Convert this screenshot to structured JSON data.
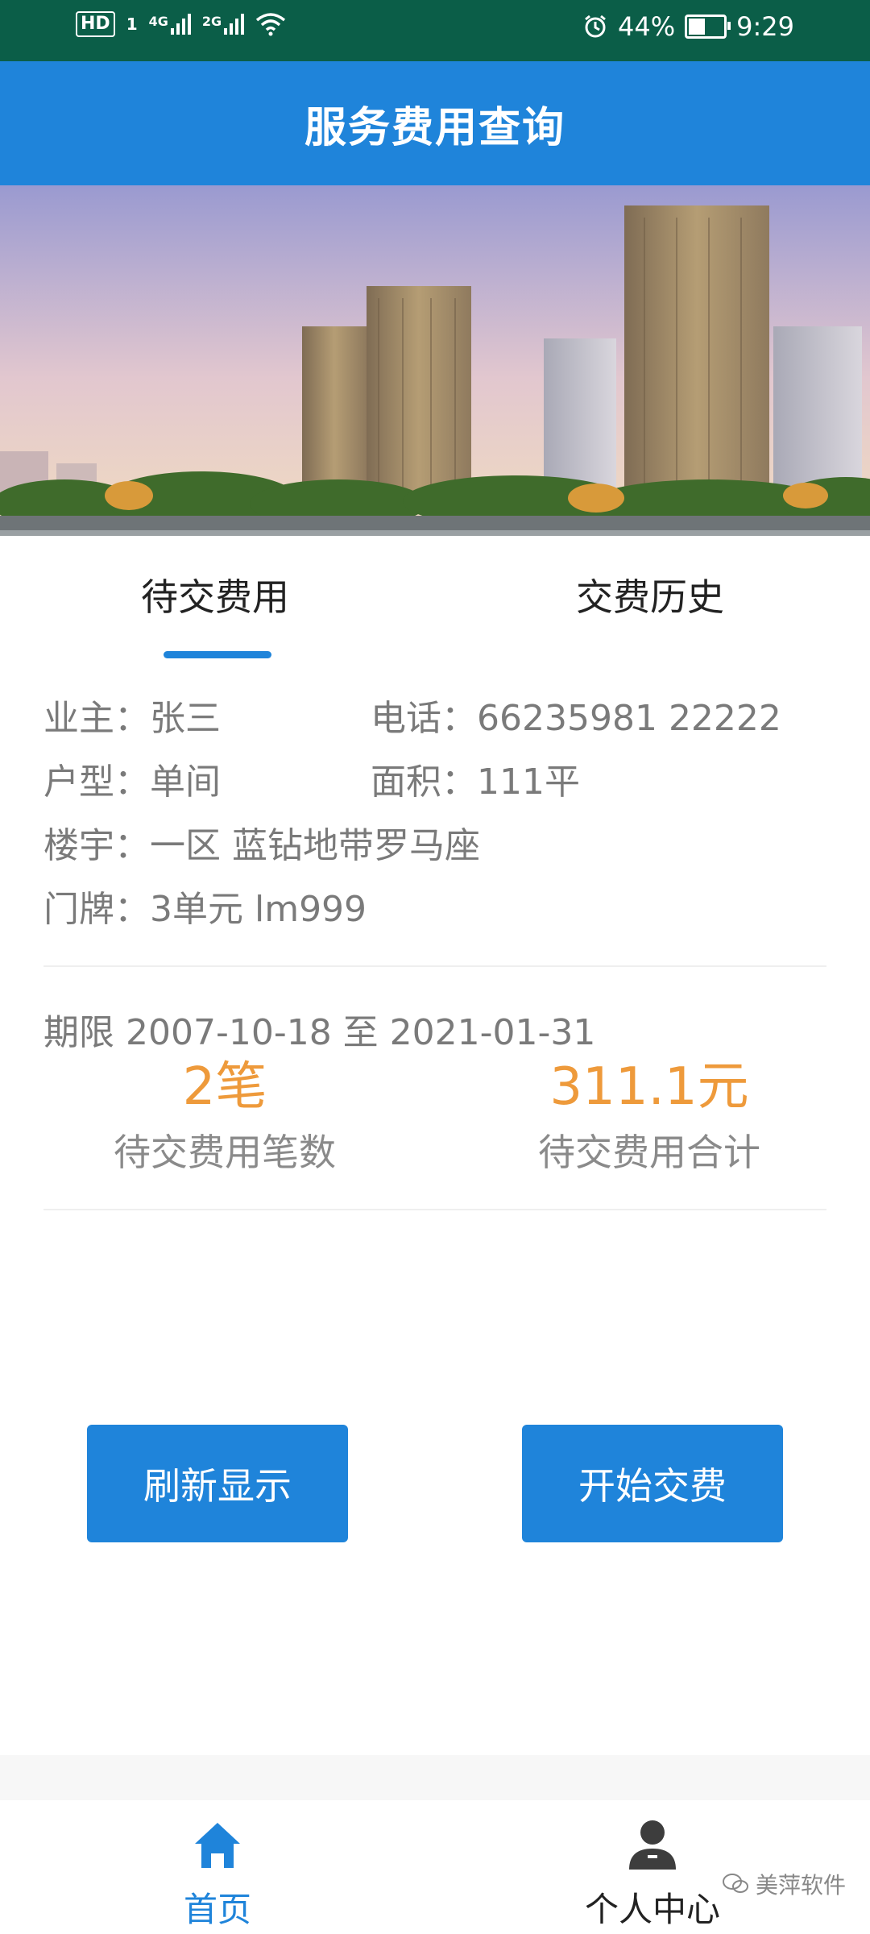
{
  "status_bar": {
    "hd": "HD",
    "sim1": "1",
    "net1": "4G",
    "net2": "2G",
    "battery_percent": "44%",
    "time": "9:29"
  },
  "header": {
    "title": "服务费用查询"
  },
  "tabs": [
    {
      "label": "待交费用",
      "active": true
    },
    {
      "label": "交费历史",
      "active": false
    }
  ],
  "owner_info": {
    "owner": "业主：张三",
    "phone": "电话：66235981 22222",
    "unit_type": "户型：单间",
    "area": "面积：111平",
    "building": "楼宇：一区 蓝钻地带罗马座",
    "door_number": "门牌：3单元 lm999"
  },
  "fees": {
    "period": "期限 2007-10-18 至 2021-01-31",
    "count_value": "2笔",
    "count_label": "待交费用笔数",
    "total_value": "311.1元",
    "total_label": "待交费用合计"
  },
  "actions": {
    "refresh": "刷新显示",
    "pay": "开始交费"
  },
  "bottom_nav": [
    {
      "label": "首页",
      "icon": "home-icon",
      "active": true
    },
    {
      "label": "个人中心",
      "icon": "person-icon",
      "active": false
    }
  ],
  "watermark": "美萍软件",
  "colors": {
    "primary": "#1f84da",
    "accent": "#ee9a3b",
    "status_bar": "#0b5e48"
  }
}
